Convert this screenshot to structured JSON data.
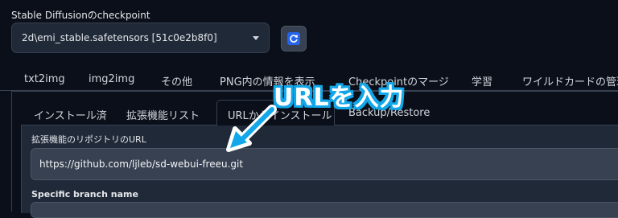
{
  "checkpoint": {
    "label": "Stable Diffusionのcheckpoint",
    "value": "2d\\emi_stable.safetensors [51c0e2b8f0]"
  },
  "top_tabs": [
    "txt2img",
    "img2img",
    "その他",
    "PNG内の情報を表示",
    "Checkpointのマージ",
    "学習",
    "ワイルドカードの管理"
  ],
  "sub_tabs": [
    "インストール済",
    "拡張機能リスト",
    "URLからインストール",
    "Backup/Restore"
  ],
  "active_sub_tab": "URLからインストール",
  "url_field": {
    "label": "拡張機能のリポジトリのURL",
    "value": "https://github.com/ljleb/sd-webui-freeu.git"
  },
  "branch_field": {
    "label": "Specific branch name"
  },
  "annotation": {
    "text": "URLを入力",
    "color": "#12a7e8"
  },
  "icons": {
    "refresh": "refresh-icon",
    "dropdown": "chevron-down-icon",
    "arrow": "arrow-icon"
  }
}
